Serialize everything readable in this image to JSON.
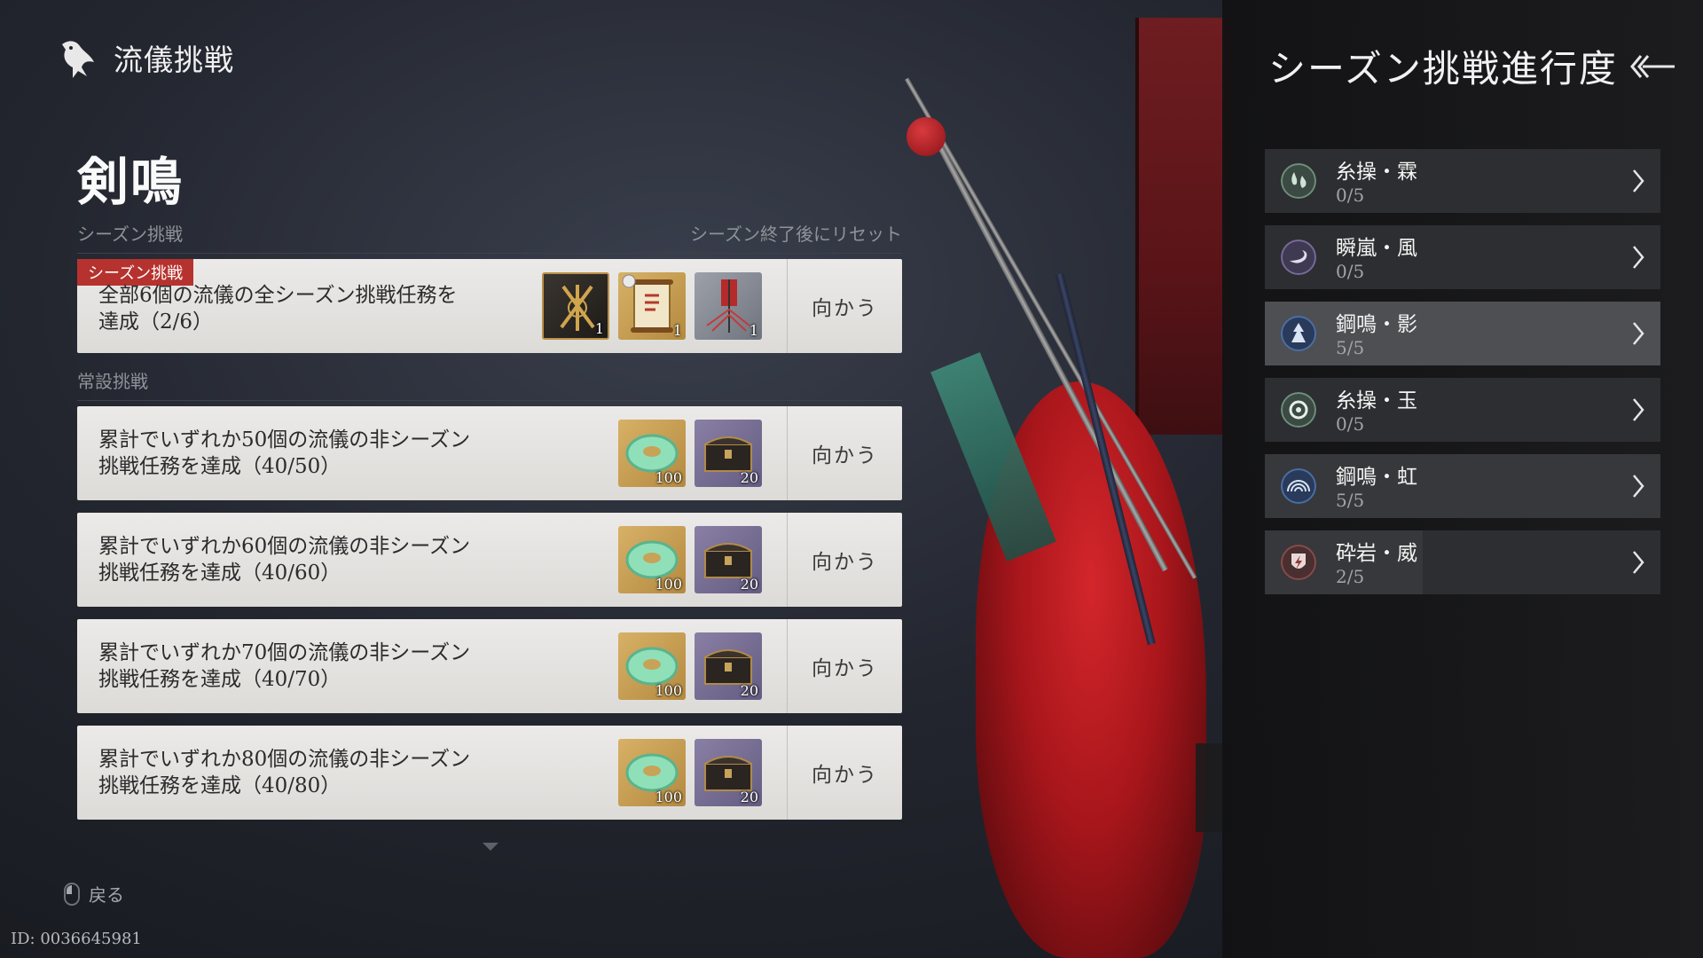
{
  "header": {
    "title": "流儀挑戦"
  },
  "school": {
    "title": "剣鳴"
  },
  "season_section": {
    "label": "シーズン挑戦",
    "reset_note": "シーズン終了後にリセット"
  },
  "season_task": {
    "badge": "シーズン挑戦",
    "line1": "全部6個の流儀の全シーズン挑戦任務を",
    "line2": "達成（2/6）",
    "rewards": [
      {
        "icon": "weapon-crest-icon",
        "count": "1"
      },
      {
        "icon": "scroll-icon",
        "count": "1"
      },
      {
        "icon": "banner-icon",
        "count": "1"
      }
    ],
    "go_label": "向かう"
  },
  "permanent_section": {
    "label": "常設挑戦"
  },
  "permanent_tasks": [
    {
      "line1": "累計でいずれか50個の流儀の非シーズン",
      "line2": "挑戦任務を達成（40/50）",
      "reward1": "100",
      "reward2": "20",
      "go_label": "向かう"
    },
    {
      "line1": "累計でいずれか60個の流儀の非シーズン",
      "line2": "挑戦任務を達成（40/60）",
      "reward1": "100",
      "reward2": "20",
      "go_label": "向かう"
    },
    {
      "line1": "累計でいずれか70個の流儀の非シーズン",
      "line2": "挑戦任務を達成（40/70）",
      "reward1": "100",
      "reward2": "20",
      "go_label": "向かう"
    },
    {
      "line1": "累計でいずれか80個の流儀の非シーズン",
      "line2": "挑戦任務を達成（40/80）",
      "reward1": "100",
      "reward2": "20",
      "go_label": "向かう"
    }
  ],
  "footer": {
    "back_label": "戻る",
    "user_id": "ID: 0036645981"
  },
  "progress_panel": {
    "title": "シーズン挑戦進行度",
    "items": [
      {
        "name": "糸操・霖",
        "count": "0/5",
        "progress": 0,
        "icon": "raindrop-icon",
        "icon_color": "#6f8f7c"
      },
      {
        "name": "瞬嵐・風",
        "count": "0/5",
        "progress": 0,
        "icon": "wind-swirl-icon",
        "icon_color": "#7a6a9a"
      },
      {
        "name": "鋼鳴・影",
        "count": "5/5",
        "progress": 1,
        "icon": "shadow-figure-icon",
        "icon_color": "#4a6fa8"
      },
      {
        "name": "糸操・玉",
        "count": "0/5",
        "progress": 0,
        "icon": "orb-swirl-icon",
        "icon_color": "#6f8f7c"
      },
      {
        "name": "鋼鳴・虹",
        "count": "5/5",
        "progress": 1,
        "icon": "rainbow-icon",
        "icon_color": "#4a6fa8"
      },
      {
        "name": "砕岩・威",
        "count": "2/5",
        "progress": 0.4,
        "icon": "lightning-shield-icon",
        "icon_color": "#8a4a4a"
      }
    ]
  },
  "colors": {
    "badge_red": "#b6322e",
    "card_bg": "#e5e3e0",
    "panel_bg": "#1c1c1e"
  }
}
